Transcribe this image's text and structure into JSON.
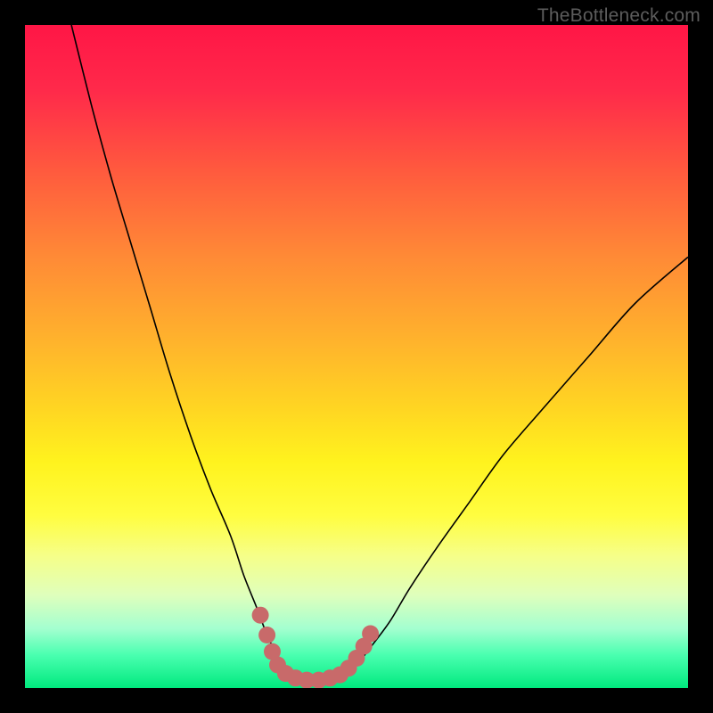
{
  "watermark": "TheBottleneck.com",
  "colors": {
    "frame": "#000000",
    "curve": "#000000",
    "marker": "#c86a6a",
    "gradient_top": "#ff1646",
    "gradient_bottom": "#00e97e"
  },
  "chart_data": {
    "type": "line",
    "title": "",
    "xlabel": "",
    "ylabel": "",
    "xlim": [
      0,
      100
    ],
    "ylim": [
      0,
      100
    ],
    "series": [
      {
        "name": "left-branch",
        "x": [
          7,
          10,
          13,
          16,
          19,
          22,
          25,
          28,
          31,
          33,
          35,
          36.5,
          38,
          39,
          40
        ],
        "y": [
          100,
          88,
          77,
          67,
          57,
          47,
          38,
          30,
          23,
          17,
          12,
          8,
          5,
          3,
          2
        ]
      },
      {
        "name": "valley-floor",
        "x": [
          40,
          41,
          42,
          43,
          44,
          45,
          46,
          47,
          48
        ],
        "y": [
          2,
          1.3,
          1,
          0.8,
          0.8,
          1,
          1.3,
          1.7,
          2
        ]
      },
      {
        "name": "right-branch",
        "x": [
          48,
          50,
          52,
          55,
          58,
          62,
          67,
          72,
          78,
          85,
          92,
          100
        ],
        "y": [
          2,
          3.5,
          6,
          10,
          15,
          21,
          28,
          35,
          42,
          50,
          58,
          65
        ]
      }
    ],
    "markers": {
      "name": "highlighted-points",
      "color": "#c86a6a",
      "points": [
        {
          "x": 35.5,
          "y": 11
        },
        {
          "x": 36.5,
          "y": 8
        },
        {
          "x": 37.3,
          "y": 5.5
        },
        {
          "x": 38.1,
          "y": 3.5
        },
        {
          "x": 39.3,
          "y": 2.2
        },
        {
          "x": 40.8,
          "y": 1.5
        },
        {
          "x": 42.5,
          "y": 1.2
        },
        {
          "x": 44.3,
          "y": 1.2
        },
        {
          "x": 46.0,
          "y": 1.5
        },
        {
          "x": 47.5,
          "y": 2.0
        },
        {
          "x": 48.8,
          "y": 3.0
        },
        {
          "x": 50.0,
          "y": 4.5
        },
        {
          "x": 51.1,
          "y": 6.3
        },
        {
          "x": 52.1,
          "y": 8.2
        }
      ]
    }
  }
}
